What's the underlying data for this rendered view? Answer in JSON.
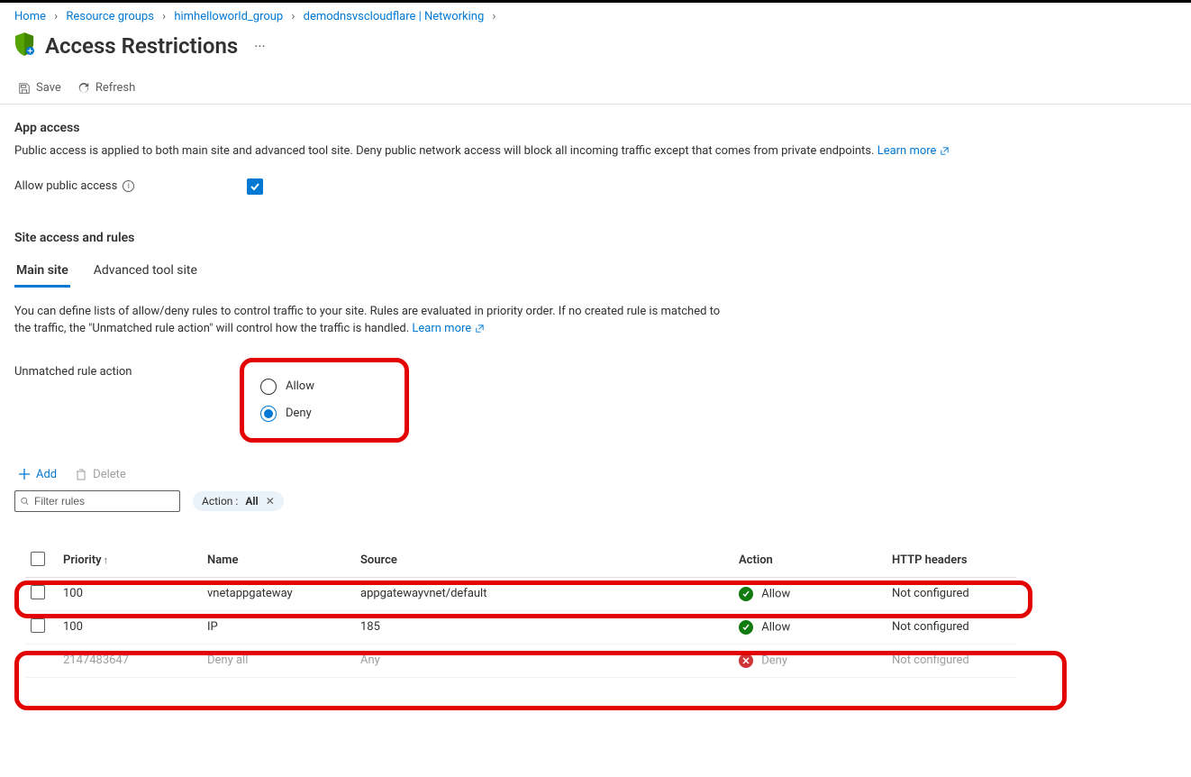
{
  "breadcrumb": {
    "items": [
      {
        "label": "Home"
      },
      {
        "label": "Resource groups"
      },
      {
        "label": "himhelloworld_group"
      },
      {
        "label": "demodnsvscloudflare | Networking"
      }
    ]
  },
  "header": {
    "title": "Access Restrictions",
    "ellipsis": "···"
  },
  "commands": {
    "save": "Save",
    "refresh": "Refresh"
  },
  "app_access": {
    "heading": "App access",
    "desc": "Public access is applied to both main site and advanced tool site. Deny public network access will block all incoming traffic except that comes from private endpoints.",
    "learn_more": "Learn more",
    "allow_public_label": "Allow public access"
  },
  "site_rules": {
    "heading": "Site access and rules",
    "tabs": [
      {
        "label": "Main site",
        "active": true
      },
      {
        "label": "Advanced tool site",
        "active": false
      }
    ],
    "desc1": "You can define lists of allow/deny rules to control traffic to your site. Rules are evaluated in priority order. If no created rule is matched to",
    "desc2": "the traffic, the \"Unmatched rule action\" will control how the traffic is handled.",
    "learn_more": "Learn more",
    "unmatched_label": "Unmatched rule action",
    "radio_allow": "Allow",
    "radio_deny": "Deny"
  },
  "list_cmds": {
    "add": "Add",
    "delete": "Delete"
  },
  "filter": {
    "placeholder": "Filter rules",
    "pill_label": "Action : ",
    "pill_value": "All"
  },
  "table": {
    "headers": {
      "priority": "Priority",
      "name": "Name",
      "source": "Source",
      "action": "Action",
      "http": "HTTP headers"
    },
    "rows": [
      {
        "priority": "100",
        "name": "vnetappgateway",
        "source": "appgatewayvnet/default",
        "action": "Allow",
        "action_type": "allow",
        "http": "Not configured",
        "checkbox": true
      },
      {
        "priority": "100",
        "name": "IP",
        "source": "185",
        "action": "Allow",
        "action_type": "allow",
        "http": "Not configured",
        "checkbox": true
      },
      {
        "priority": "2147483647",
        "name": "Deny all",
        "source": "Any",
        "action": "Deny",
        "action_type": "deny",
        "http": "Not configured",
        "checkbox": false
      }
    ]
  }
}
